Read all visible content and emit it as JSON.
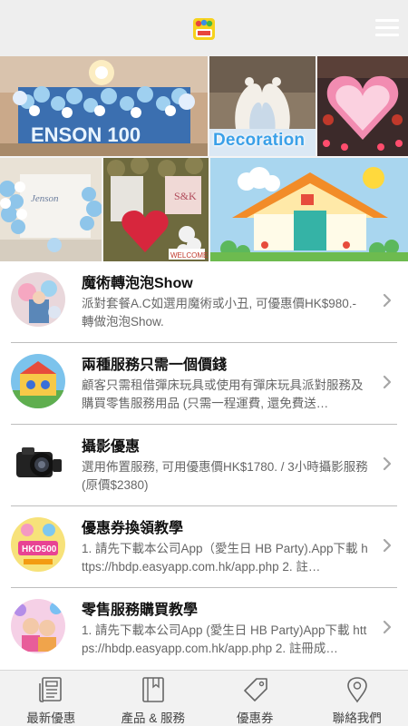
{
  "header": {
    "logo_icon": "app-logo-icon",
    "menu_icon": "hamburger-menu-icon",
    "background": "#eeeeee"
  },
  "banner": {
    "decoration_label": "Decoration",
    "tiles": [
      {
        "name": "blue-balloon-wall-photo"
      },
      {
        "name": "swan-balloon-decoration-photo"
      },
      {
        "name": "heart-balloon-arch-photo"
      },
      {
        "name": "baby-celebration-backdrop-photo"
      },
      {
        "name": "heart-balloon-flower-wall-photo"
      },
      {
        "name": "balloon-house-photo"
      }
    ]
  },
  "list": {
    "items": [
      {
        "title": "魔術轉泡泡Show",
        "desc": "派對套餐A.C如選用魔術或小丑, 可優惠價HK$980.- 轉做泡泡Show.",
        "thumb": "magic-bubble-show-thumb"
      },
      {
        "title": "兩種服務只需一個價錢",
        "desc": "顧客只需租借彈床玩具或使用有彈床玩具派對服務及購買零售服務用品 (只需一程運費, 還免費送…",
        "thumb": "bouncy-castle-thumb"
      },
      {
        "title": "攝影優惠",
        "desc": "選用佈置服務, 可用優惠價HK$1780. / 3小時攝影服務 (原價$2380)",
        "thumb": "camera-thumb"
      },
      {
        "title": "優惠券換領教學",
        "desc": "1. 請先下載本公司App（愛生日 HB Party).App下載 https://hbdp.easyapp.com.hk/app.php 2. 註…",
        "thumb": "coupon-hkd500-thumb"
      },
      {
        "title": "零售服務購買教學",
        "desc": "1. 請先下載本公司App (愛生日 HB Party)App下載 https://hbdp.easyapp.com.hk/app.php 2. 註冊成…",
        "thumb": "party-kids-thumb"
      }
    ]
  },
  "tabbar": {
    "tabs": [
      {
        "label": "最新優惠",
        "icon": "news-icon"
      },
      {
        "label": "產品 & 服務",
        "icon": "book-icon"
      },
      {
        "label": "優惠券",
        "icon": "tag-icon"
      },
      {
        "label": "聯絡我們",
        "icon": "location-pin-icon"
      }
    ]
  }
}
